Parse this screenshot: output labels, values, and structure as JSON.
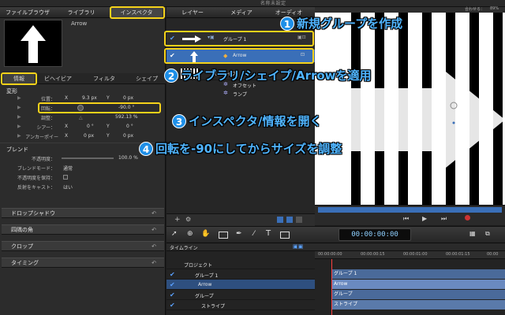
{
  "window_title": "名称未設定",
  "left_tabs": [
    "ファイルブラウザ",
    "ライブラリ",
    "インスペクタ"
  ],
  "preview_name": "Arrow",
  "sub_tabs": [
    "情報",
    "ビヘイビア",
    "フィルタ",
    "シェイプ"
  ],
  "transform": {
    "section": "変形",
    "position": {
      "label": "位置：",
      "x_label": "X",
      "x_value": "9.3 px",
      "y_label": "Y",
      "y_value": "0 px"
    },
    "rotation": {
      "label": "回転：",
      "value": "-90.0 °"
    },
    "scale": {
      "label": "調整：",
      "value": "592.13 %"
    },
    "shear": {
      "label": "シアー：",
      "x_label": "X",
      "x_value": "0 °",
      "y_label": "Y",
      "y_value": "0 °"
    },
    "anchor": {
      "label": "アンカーポイー",
      "x_label": "X",
      "x_value": "0 px",
      "y_label": "Y",
      "y_value": "0 px"
    }
  },
  "blend": {
    "section": "ブレンド",
    "opacity": {
      "label": "不透明度：",
      "value": "100.0 %"
    },
    "mode": {
      "label": "ブレンドモード：",
      "value": "通常"
    },
    "preserve": {
      "label": "不透明度を保持："
    },
    "cast": {
      "label": "反射をキャスト：",
      "value": "はい"
    }
  },
  "collapsed_sections": [
    "ドロップシャドウ",
    "四隅の角",
    "クロップ",
    "タイミング"
  ],
  "mid_tabs": [
    "レイヤー",
    "メディア",
    "オーディオ"
  ],
  "layers": [
    {
      "name": "グループ 1"
    },
    {
      "name": "Arrow"
    },
    {
      "name": "ストライプ"
    },
    {
      "name": "オフセット"
    },
    {
      "name": "ランプ"
    }
  ],
  "canvas": {
    "zoom_label": "合わせる：",
    "zoom_value": "89%"
  },
  "timecode": "00:00:00:00",
  "timeline": {
    "title": "タイムライン",
    "project": "プロジェクト",
    "rows": [
      "グループ 1",
      "Arrow",
      "グループ",
      "ストライプ"
    ],
    "ruler": [
      "00:00:00:00",
      "00:00:00:15",
      "00:00:01:00",
      "00:00:01:15",
      "00:00"
    ],
    "bars": [
      "グループ 1",
      "Arrow",
      "グループ",
      "ストライプ"
    ]
  },
  "annotations": [
    {
      "num": "1",
      "text": "新規グループを作成"
    },
    {
      "num": "2",
      "text": "ライブラリ/シェイプ/Arrowを適用"
    },
    {
      "num": "3",
      "text": "インスペクタ/情報を開く"
    },
    {
      "num": "4",
      "text": "回転を-90にしてからサイズを調整"
    }
  ],
  "colors": {
    "annotation": "#4fb4ff",
    "highlight": "#f5d21a",
    "selection": "#3a6fb8"
  }
}
